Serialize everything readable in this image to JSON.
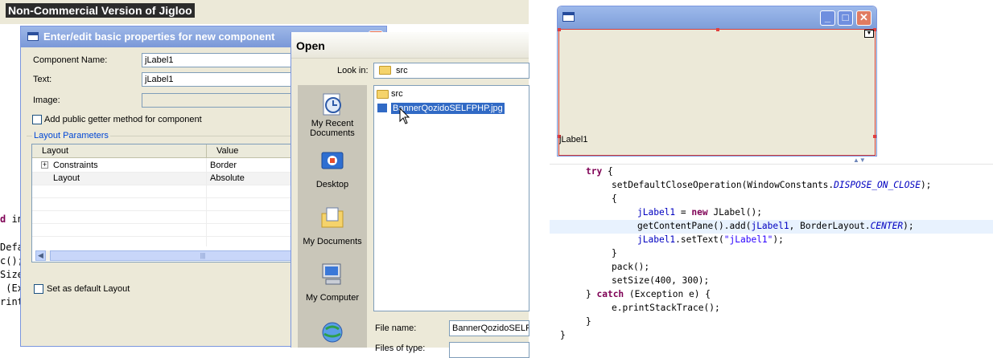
{
  "banner": {
    "text": "Non-Commercial Version of Jigloo"
  },
  "background_code": {
    "lines": [
      {
        "prefix_kw": "d",
        "rest": " in"
      },
      {
        "text": "Defa"
      },
      {
        "text": "c();"
      },
      {
        "text": "Size"
      },
      {
        "text": " (Ex"
      },
      {
        "text": "rint"
      }
    ]
  },
  "props_dialog": {
    "title": "Enter/edit basic properties for new component",
    "component_name_label": "Component Name:",
    "component_name_value": "jLabel1",
    "text_label": "Text:",
    "text_value": "jLabel1",
    "image_label": "Image:",
    "getter_checkbox_label": "Add public getter method for component",
    "layout_group_title": "Layout Parameters",
    "table": {
      "headers": [
        "Layout",
        "Value"
      ],
      "rows": [
        {
          "name": "Constraints",
          "value": "Border"
        },
        {
          "name": "Layout",
          "value": "Absolute"
        }
      ]
    },
    "scroll_thumb_glyph": "|||",
    "default_layout_checkbox_label": "Set as default Layout"
  },
  "open_dialog": {
    "title": "Open",
    "look_in_label": "Look in:",
    "look_in_value": "src",
    "places": [
      {
        "label_line1": "My Recent",
        "label_line2": "Documents",
        "icon": "recent-documents-icon"
      },
      {
        "label_line1": "Desktop",
        "label_line2": "",
        "icon": "desktop-icon"
      },
      {
        "label_line1": "My Documents",
        "label_line2": "",
        "icon": "my-documents-icon"
      },
      {
        "label_line1": "My Computer",
        "label_line2": "",
        "icon": "my-computer-icon"
      },
      {
        "label_line1": "",
        "label_line2": "",
        "icon": "network-icon"
      }
    ],
    "files": [
      {
        "name": "src",
        "type": "folder"
      },
      {
        "name": "BannerQozidoSELFPHP.jpg",
        "type": "image",
        "selected": true
      }
    ],
    "file_name_label": "File name:",
    "file_name_value": "BannerQozidoSELFPHP.jpg",
    "files_of_type_label": "Files of type:"
  },
  "preview": {
    "label_text": "jLabel1",
    "minimize_glyph": "_",
    "maximize_glyph": "□",
    "close_glyph": "✕",
    "dropdown_glyph": "▼",
    "sash_glyph": "▲▼"
  },
  "code": {
    "lines": [
      {
        "indent": 4,
        "parts": [
          {
            "t": "try",
            "c": "kw"
          },
          {
            "t": " {",
            "c": ""
          }
        ]
      },
      {
        "indent": 8,
        "parts": [
          {
            "t": "setDefaultCloseOperation(WindowConstants.",
            "c": ""
          },
          {
            "t": "DISPOSE_ON_CLOSE",
            "c": "italic-const"
          },
          {
            "t": ");",
            "c": ""
          }
        ]
      },
      {
        "indent": 8,
        "parts": [
          {
            "t": "{",
            "c": ""
          }
        ]
      },
      {
        "indent": 12,
        "parts": [
          {
            "t": "jLabel1",
            "c": "field"
          },
          {
            "t": " = ",
            "c": ""
          },
          {
            "t": "new",
            "c": "kw"
          },
          {
            "t": " JLabel();",
            "c": ""
          }
        ]
      },
      {
        "indent": 12,
        "parts": [
          {
            "t": "getContentPane().add(",
            "c": ""
          },
          {
            "t": "jLabel1",
            "c": "field"
          },
          {
            "t": ", BorderLayout.",
            "c": ""
          },
          {
            "t": "CENTER",
            "c": "italic-const"
          },
          {
            "t": ");",
            "c": ""
          }
        ]
      },
      {
        "indent": 12,
        "parts": [
          {
            "t": "jLabel1",
            "c": "field"
          },
          {
            "t": ".setText(",
            "c": ""
          },
          {
            "t": "\"jLabel1\"",
            "c": "str"
          },
          {
            "t": ");",
            "c": ""
          }
        ]
      },
      {
        "indent": 8,
        "parts": [
          {
            "t": "}",
            "c": ""
          }
        ]
      },
      {
        "indent": 8,
        "parts": [
          {
            "t": "pack();",
            "c": ""
          }
        ]
      },
      {
        "indent": 8,
        "parts": [
          {
            "t": "setSize(400, 300);",
            "c": ""
          }
        ]
      },
      {
        "indent": 4,
        "parts": [
          {
            "t": "} ",
            "c": ""
          },
          {
            "t": "catch",
            "c": "kw"
          },
          {
            "t": " (Exception e) {",
            "c": ""
          }
        ]
      },
      {
        "indent": 8,
        "parts": [
          {
            "t": "e.printStackTrace();",
            "c": ""
          }
        ]
      },
      {
        "indent": 4,
        "parts": [
          {
            "t": "}",
            "c": ""
          }
        ]
      },
      {
        "indent": 0,
        "parts": [
          {
            "t": "}",
            "c": ""
          }
        ]
      }
    ]
  }
}
